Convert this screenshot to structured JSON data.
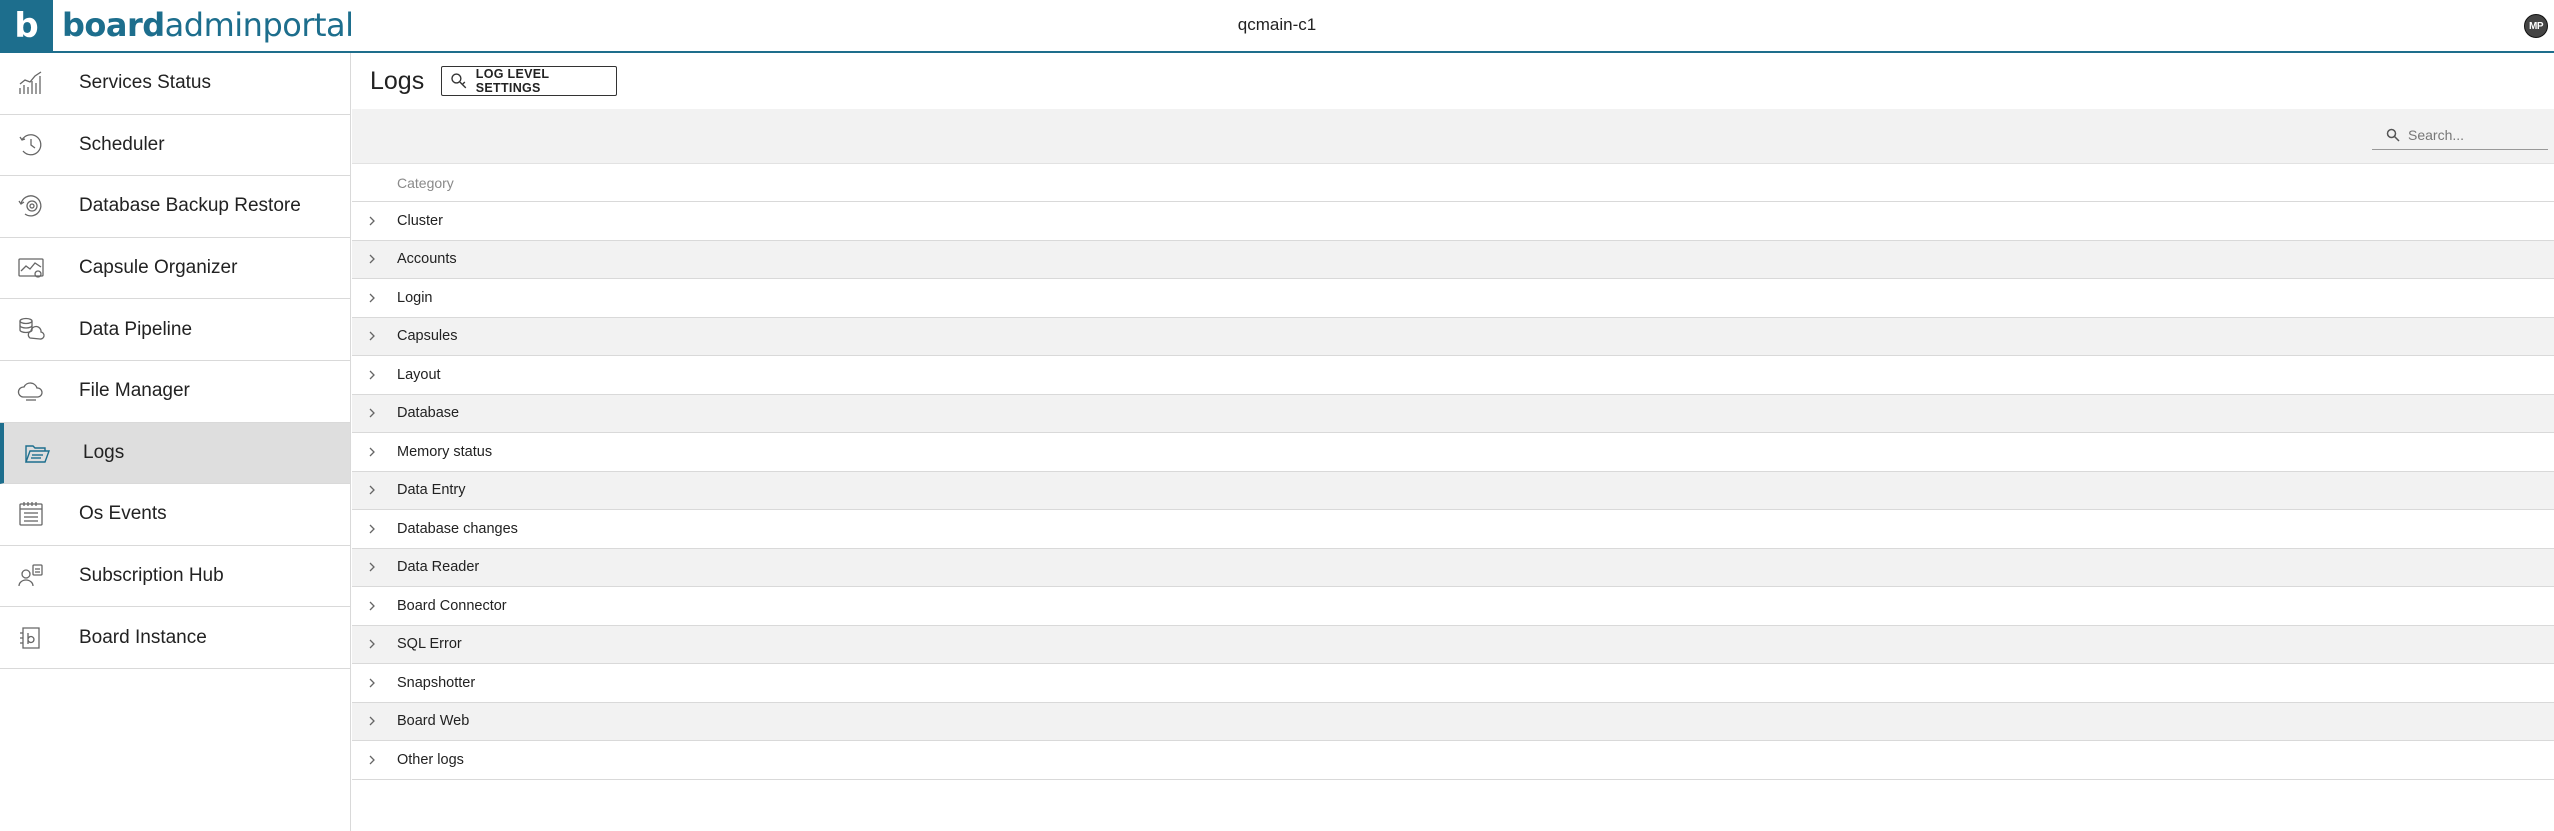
{
  "header": {
    "logo_letter": "b",
    "brand_bold": "board",
    "brand_light": "adminportal",
    "instance_name": "qcmain-c1",
    "user_initials": "MP"
  },
  "colors": {
    "brand": "#1d6e8d",
    "active_bg": "#dedede",
    "row_alt": "#f2f2f2"
  },
  "sidebar": {
    "items": [
      {
        "label": "Services Status",
        "icon": "services-status-icon"
      },
      {
        "label": "Scheduler",
        "icon": "scheduler-clock-icon"
      },
      {
        "label": "Database Backup Restore",
        "icon": "database-backup-icon"
      },
      {
        "label": "Capsule Organizer",
        "icon": "capsule-organizer-icon"
      },
      {
        "label": "Data Pipeline",
        "icon": "data-pipeline-icon"
      },
      {
        "label": "File Manager",
        "icon": "file-manager-cloud-icon"
      },
      {
        "label": "Logs",
        "icon": "logs-folder-icon",
        "active": true
      },
      {
        "label": "Os Events",
        "icon": "os-events-calendar-icon"
      },
      {
        "label": "Subscription Hub",
        "icon": "subscription-hub-icon"
      },
      {
        "label": "Board Instance",
        "icon": "board-instance-icon"
      }
    ]
  },
  "main": {
    "title": "Logs",
    "log_level_button": "LOG LEVEL SETTINGS",
    "search_placeholder": "Search...",
    "table": {
      "column_header": "Category",
      "rows": [
        "Cluster",
        "Accounts",
        "Login",
        "Capsules",
        "Layout",
        "Database",
        "Memory status",
        "Data Entry",
        "Database changes",
        "Data Reader",
        "Board Connector",
        "SQL Error",
        "Snapshotter",
        "Board Web",
        "Other logs"
      ]
    }
  }
}
